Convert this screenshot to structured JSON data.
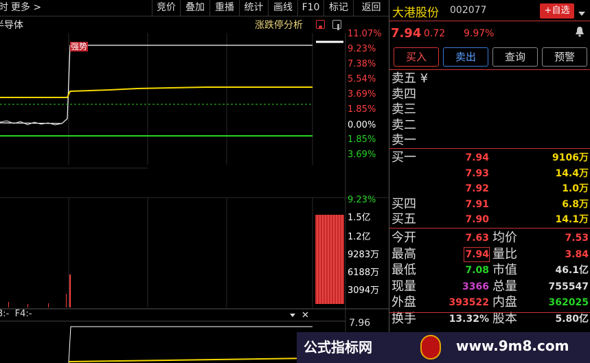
{
  "toolbar": {
    "left_items": [
      "时",
      "更多 >"
    ],
    "items": [
      "竞价",
      "叠加",
      "重播",
      "统计",
      "画线",
      "F10",
      "标记",
      "返回"
    ]
  },
  "subbar": {
    "sector": "半导体",
    "analysis": "涨跌停分析"
  },
  "chart": {
    "pct_labels": [
      "11.07%",
      "9.23%",
      "7.38%",
      "5.54%",
      "3.69%",
      "1.85%",
      "0.00%",
      "1.85%",
      "3.69%"
    ],
    "pct_colors": [
      "#ff4040",
      "#ff4040",
      "#ff4040",
      "#ff4040",
      "#ff4040",
      "#ff4040",
      "#ffffff",
      "#26d426",
      "#26d426"
    ],
    "tag": "强势",
    "vol_labels": [
      "9.23%",
      "1.5亿",
      "1.2亿",
      "9283万",
      "6188万",
      "3094万"
    ],
    "vol_colors": [
      "#26d426",
      "#ffffff",
      "#ffffff",
      "#ffffff",
      "#ffffff",
      "#ffffff"
    ],
    "indicator_label": "3:-  F4:-",
    "indicator_value": "7.96"
  },
  "quote": {
    "name": "大港股份",
    "code": "002077",
    "add_label": "+自选",
    "price": "7.94",
    "change": "0.72",
    "change_pct": "9.97%",
    "buttons": [
      "买入",
      "卖出",
      "查询",
      "预警"
    ],
    "sell_labels": [
      "卖五 ¥",
      "卖四",
      "卖三",
      "卖二",
      "卖一"
    ],
    "buy_rows": [
      {
        "label": "买一",
        "price": "7.94",
        "vol": "9106万"
      },
      {
        "label": "",
        "price": "7.93",
        "vol": "14.4万"
      },
      {
        "label": "",
        "price": "7.92",
        "vol": "1.0万"
      },
      {
        "label": "买四",
        "price": "7.91",
        "vol": "6.8万"
      },
      {
        "label": "买五",
        "price": "7.90",
        "vol": "14.1万"
      }
    ],
    "stats": [
      {
        "l1": "今开",
        "v1": "7.63",
        "c1": "#ff4040",
        "l2": "均价",
        "v2": "7.53",
        "c2": "#ff4040"
      },
      {
        "l1": "最高",
        "v1": "7.94",
        "c1": "#ff4040",
        "l2": "量比",
        "v2": "3.84",
        "c2": "#ff4040"
      },
      {
        "l1": "最低",
        "v1": "7.08",
        "c1": "#26d426",
        "l2": "市值",
        "v2": "46.1亿",
        "c2": "#dddddd"
      },
      {
        "l1": "现量",
        "v1": "3366",
        "c1": "#cc44cc",
        "l2": "总量",
        "v2": "755547",
        "c2": "#dddddd"
      },
      {
        "l1": "外盘",
        "v1": "393522",
        "c1": "#ff4040",
        "l2": "内盘",
        "v2": "362025",
        "c2": "#26d426"
      },
      {
        "l1": "换手",
        "v1": "13.32%",
        "c1": "#dddddd",
        "l2": "股本",
        "v2": "5.80亿",
        "c2": "#dddddd"
      }
    ]
  },
  "watermark": {
    "text1": "公式指标网",
    "text2": "www.9m8.com"
  },
  "colors": {
    "up": "#ff4040",
    "down": "#26d426",
    "yellow": "#f5d800"
  }
}
